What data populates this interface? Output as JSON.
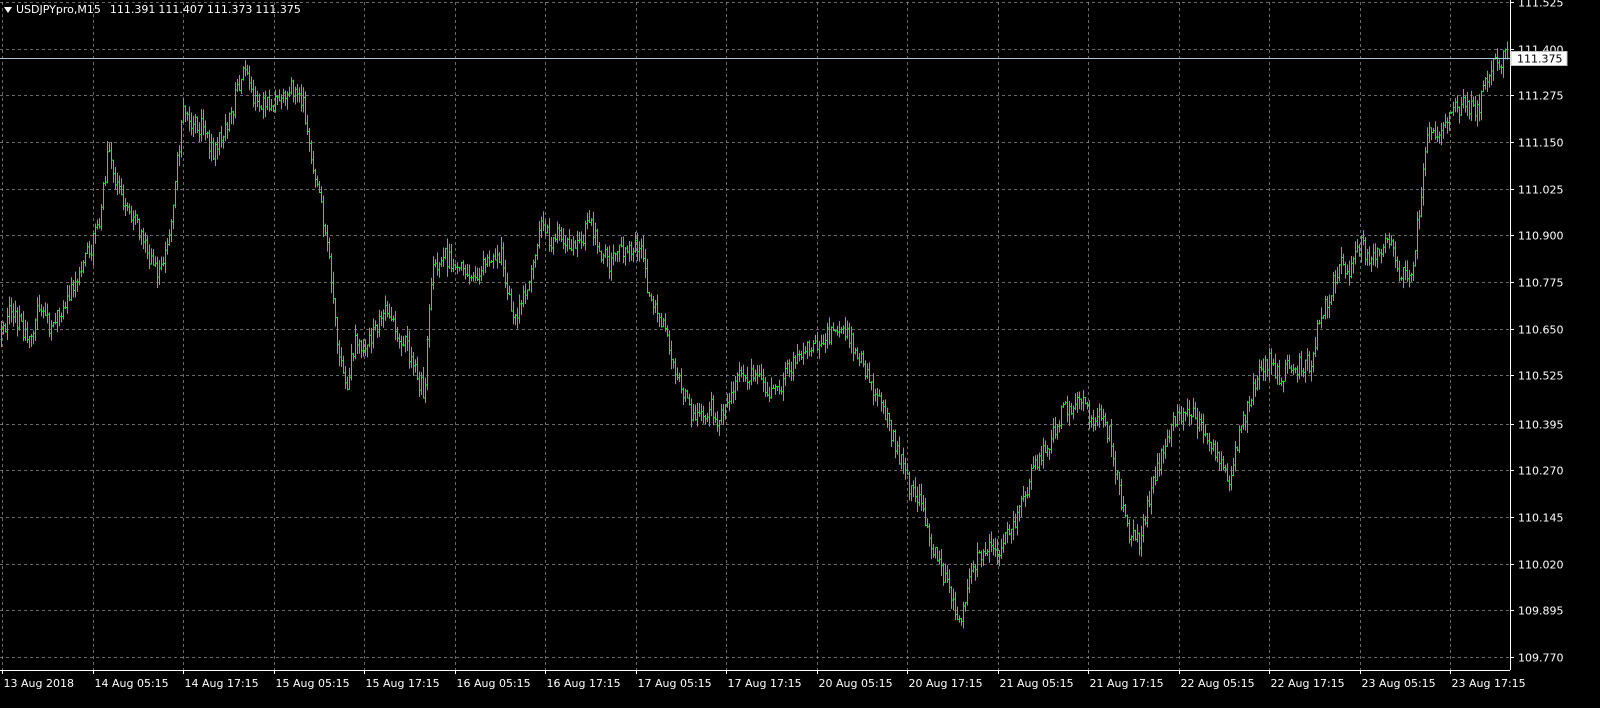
{
  "chart_data": {
    "type": "bar",
    "bar_style": "ohlc",
    "title": "USDJPYpro,M15",
    "ohlc_header": [
      "111.391",
      "111.407",
      "111.373",
      "111.375"
    ],
    "current_price": 111.375,
    "current_price_label": "111.375",
    "ylim": [
      109.735,
      111.525
    ],
    "y_ticks": [
      "111.525",
      "111.400",
      "111.275",
      "111.150",
      "111.025",
      "110.900",
      "110.775",
      "110.650",
      "110.525",
      "110.395",
      "110.270",
      "110.145",
      "110.020",
      "109.895",
      "109.770"
    ],
    "x_ticks": [
      "13 Aug 2018",
      "14 Aug 05:15",
      "14 Aug 17:15",
      "15 Aug 05:15",
      "15 Aug 17:15",
      "16 Aug 05:15",
      "16 Aug 17:15",
      "17 Aug 05:15",
      "17 Aug 17:15",
      "20 Aug 05:15",
      "20 Aug 17:15",
      "21 Aug 05:15",
      "21 Aug 17:15",
      "22 Aug 05:15",
      "22 Aug 17:15",
      "23 Aug 05:15",
      "23 Aug 17:15"
    ],
    "grid": true,
    "colors": {
      "background": "#000000",
      "bars": "#00ff00",
      "grid": "#c0c0c0",
      "axis": "#ffffff",
      "text": "#ffffff",
      "price_line": "#b0c4de"
    },
    "trajectory": [
      [
        0,
        110.62
      ],
      [
        10,
        110.7
      ],
      [
        20,
        110.66
      ],
      [
        30,
        110.63
      ],
      [
        40,
        110.72
      ],
      [
        50,
        110.64
      ],
      [
        60,
        110.7
      ],
      [
        70,
        110.74
      ],
      [
        80,
        110.82
      ],
      [
        90,
        110.86
      ],
      [
        100,
        110.95
      ],
      [
        108,
        111.12
      ],
      [
        118,
        111.02
      ],
      [
        128,
        110.98
      ],
      [
        138,
        110.92
      ],
      [
        148,
        110.84
      ],
      [
        158,
        110.8
      ],
      [
        168,
        110.87
      ],
      [
        175,
        111.05
      ],
      [
        183,
        111.23
      ],
      [
        193,
        111.2
      ],
      [
        203,
        111.19
      ],
      [
        213,
        111.12
      ],
      [
        223,
        111.18
      ],
      [
        233,
        111.24
      ],
      [
        243,
        111.36
      ],
      [
        252,
        111.27
      ],
      [
        262,
        111.25
      ],
      [
        272,
        111.24
      ],
      [
        282,
        111.28
      ],
      [
        292,
        111.3
      ],
      [
        302,
        111.26
      ],
      [
        312,
        111.1
      ],
      [
        320,
        111.0
      ],
      [
        330,
        110.8
      ],
      [
        338,
        110.6
      ],
      [
        346,
        110.5
      ],
      [
        356,
        110.62
      ],
      [
        366,
        110.6
      ],
      [
        376,
        110.64
      ],
      [
        386,
        110.7
      ],
      [
        396,
        110.65
      ],
      [
        406,
        110.6
      ],
      [
        416,
        110.52
      ],
      [
        424,
        110.48
      ],
      [
        432,
        110.8
      ],
      [
        442,
        110.85
      ],
      [
        452,
        110.83
      ],
      [
        462,
        110.82
      ],
      [
        472,
        110.77
      ],
      [
        482,
        110.81
      ],
      [
        492,
        110.85
      ],
      [
        502,
        110.84
      ],
      [
        512,
        110.67
      ],
      [
        522,
        110.72
      ],
      [
        532,
        110.8
      ],
      [
        540,
        110.95
      ],
      [
        550,
        110.88
      ],
      [
        560,
        110.9
      ],
      [
        570,
        110.86
      ],
      [
        580,
        110.89
      ],
      [
        590,
        110.93
      ],
      [
        600,
        110.86
      ],
      [
        610,
        110.82
      ],
      [
        620,
        110.86
      ],
      [
        630,
        110.87
      ],
      [
        640,
        110.86
      ],
      [
        650,
        110.73
      ],
      [
        660,
        110.68
      ],
      [
        670,
        110.6
      ],
      [
        680,
        110.5
      ],
      [
        690,
        110.42
      ],
      [
        700,
        110.4
      ],
      [
        710,
        110.44
      ],
      [
        720,
        110.4
      ],
      [
        730,
        110.48
      ],
      [
        740,
        110.52
      ],
      [
        750,
        110.53
      ],
      [
        760,
        110.5
      ],
      [
        770,
        110.47
      ],
      [
        780,
        110.5
      ],
      [
        790,
        110.55
      ],
      [
        800,
        110.57
      ],
      [
        810,
        110.6
      ],
      [
        820,
        110.62
      ],
      [
        830,
        110.63
      ],
      [
        840,
        110.64
      ],
      [
        850,
        110.62
      ],
      [
        860,
        110.58
      ],
      [
        870,
        110.5
      ],
      [
        880,
        110.45
      ],
      [
        890,
        110.38
      ],
      [
        900,
        110.3
      ],
      [
        910,
        110.22
      ],
      [
        920,
        110.18
      ],
      [
        930,
        110.08
      ],
      [
        940,
        110.0
      ],
      [
        950,
        109.95
      ],
      [
        960,
        109.85
      ],
      [
        970,
        110.0
      ],
      [
        980,
        110.05
      ],
      [
        990,
        110.08
      ],
      [
        1000,
        110.06
      ],
      [
        1010,
        110.1
      ],
      [
        1020,
        110.18
      ],
      [
        1030,
        110.25
      ],
      [
        1040,
        110.3
      ],
      [
        1050,
        110.35
      ],
      [
        1060,
        110.42
      ],
      [
        1070,
        110.44
      ],
      [
        1080,
        110.48
      ],
      [
        1090,
        110.4
      ],
      [
        1100,
        110.42
      ],
      [
        1110,
        110.36
      ],
      [
        1120,
        110.2
      ],
      [
        1130,
        110.1
      ],
      [
        1140,
        110.08
      ],
      [
        1150,
        110.2
      ],
      [
        1160,
        110.3
      ],
      [
        1170,
        110.38
      ],
      [
        1180,
        110.42
      ],
      [
        1190,
        110.43
      ],
      [
        1200,
        110.4
      ],
      [
        1210,
        110.36
      ],
      [
        1220,
        110.28
      ],
      [
        1230,
        110.25
      ],
      [
        1240,
        110.38
      ],
      [
        1250,
        110.45
      ],
      [
        1260,
        110.55
      ],
      [
        1270,
        110.56
      ],
      [
        1280,
        110.52
      ],
      [
        1290,
        110.55
      ],
      [
        1300,
        110.55
      ],
      [
        1310,
        110.56
      ],
      [
        1320,
        110.68
      ],
      [
        1330,
        110.75
      ],
      [
        1340,
        110.82
      ],
      [
        1350,
        110.8
      ],
      [
        1360,
        110.88
      ],
      [
        1370,
        110.82
      ],
      [
        1380,
        110.86
      ],
      [
        1390,
        110.88
      ],
      [
        1400,
        110.8
      ],
      [
        1410,
        110.78
      ],
      [
        1420,
        110.98
      ],
      [
        1428,
        111.22
      ],
      [
        1436,
        111.14
      ],
      [
        1446,
        111.22
      ],
      [
        1456,
        111.24
      ],
      [
        1466,
        111.26
      ],
      [
        1476,
        111.22
      ],
      [
        1486,
        111.32
      ],
      [
        1496,
        111.36
      ],
      [
        1508,
        111.39
      ]
    ]
  }
}
